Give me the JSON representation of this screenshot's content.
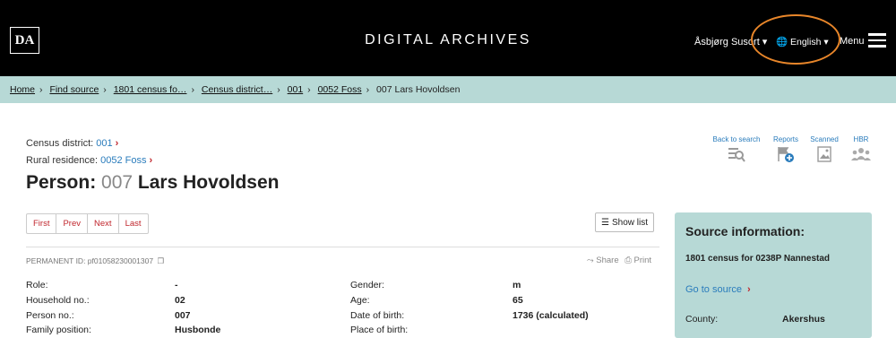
{
  "header": {
    "logo": "DA",
    "title": "DIGITAL ARCHIVES",
    "user": "Åsbjørg Susort",
    "language": "English",
    "menu": "Menu"
  },
  "breadcrumb": [
    "Home",
    "Find source",
    "1801 census fo…",
    "Census district…",
    "001",
    "0052 Foss",
    "007 Lars Hovoldsen"
  ],
  "meta": {
    "census_label": "Census district:",
    "census_value": "001",
    "rural_label": "Rural residence:",
    "rural_value": "0052 Foss"
  },
  "title": {
    "prefix": "Person:",
    "number": "007",
    "name": "Lars Hovoldsen"
  },
  "pager": [
    "First",
    "Prev",
    "Next",
    "Last"
  ],
  "show_list": "Show list",
  "permanent_id": "PERMANENT ID: pf01058230001307",
  "share": "Share",
  "print": "Print",
  "tools": [
    "Back to search",
    "Reports",
    "Scanned",
    "HBR"
  ],
  "fields_left": [
    {
      "label": "Role:",
      "value": "-"
    },
    {
      "label": "Household no.:",
      "value": "02"
    },
    {
      "label": "Person no.:",
      "value": "007"
    },
    {
      "label": "Family position:",
      "value": "Husbonde"
    }
  ],
  "fields_right": [
    {
      "label": "Gender:",
      "value": "m"
    },
    {
      "label": "Age:",
      "value": "65"
    },
    {
      "label": "Date of birth:",
      "value": "1736 (calculated)"
    },
    {
      "label": "Place of birth:",
      "value": ""
    }
  ],
  "source": {
    "title": "Source information:",
    "census": "1801 census for 0238P Nannestad",
    "goto": "Go to source",
    "county_label": "County:",
    "county_value": "Akershus"
  },
  "colors": {
    "accent_red": "#c0262d",
    "link_blue": "#2a7cbc",
    "teal": "#b7d9d6",
    "annotation": "#e8862a"
  }
}
